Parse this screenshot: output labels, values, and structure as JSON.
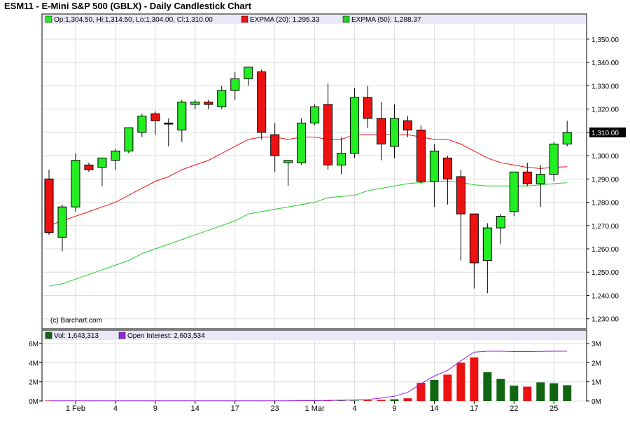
{
  "title": "ESM11 - E-Mini S&P 500 (GBLX) - Daily Candlestick Chart",
  "watermark": "(c) Barchart.com",
  "colors": {
    "up": "#22ee22",
    "down": "#ee1111",
    "ema20": "#ee1111",
    "ema50": "#22cc22",
    "oi": "#9922dd",
    "vol_up": "#116611",
    "vol_down": "#ee1111",
    "legend_bg": "#e8e8f8",
    "grid": "#dddddd"
  },
  "price_legend": {
    "ohlc": "Op:1,304.50, Hi:1,314.50, Lo:1,304.00, Cl:1,310.00",
    "ema20": "EXPMA (20): 1,295.33",
    "ema50": "EXPMA (50): 1,288.37"
  },
  "volume_legend": {
    "vol": "Vol: 1,643,313",
    "oi": "Open Interest: 2,603,534"
  },
  "last_price_label": "1,310.00",
  "chart_data": {
    "type": "candlestick",
    "x_tick_labels": [
      "1 Feb",
      "4",
      "9",
      "14",
      "17",
      "23",
      "1 Mar",
      "4",
      "9",
      "14",
      "17",
      "22",
      "25"
    ],
    "x_tick_bar_index": [
      2,
      5,
      8,
      11,
      14,
      17,
      20,
      23,
      26,
      29,
      32,
      35,
      38
    ],
    "price_axis": {
      "ylim": [
        1226,
        1356
      ],
      "ticks": [
        "1,230.00",
        "1,240.00",
        "1,250.00",
        "1,260.00",
        "1,270.00",
        "1,280.00",
        "1,290.00",
        "1,300.00",
        "1,310.00",
        "1,320.00",
        "1,330.00",
        "1,340.00",
        "1,350.00"
      ],
      "tick_values": [
        1230,
        1240,
        1250,
        1260,
        1270,
        1280,
        1290,
        1300,
        1310,
        1320,
        1330,
        1340,
        1350
      ]
    },
    "volume_left_axis": {
      "ticks": [
        "0M",
        "2M",
        "4M",
        "6M"
      ],
      "tick_values": [
        0,
        2,
        4,
        6
      ],
      "ylim": [
        0,
        6.3
      ]
    },
    "volume_right_axis": {
      "ticks": [
        "0M",
        "1M",
        "2M",
        "3M"
      ],
      "tick_values": [
        0,
        1,
        2,
        3
      ],
      "ylim": [
        0,
        3.15
      ]
    },
    "ohlc": [
      [
        1290,
        1294,
        1266,
        1267
      ],
      [
        1265,
        1279,
        1259,
        1278
      ],
      [
        1278,
        1301,
        1276,
        1298
      ],
      [
        1296,
        1297,
        1293,
        1294
      ],
      [
        1295,
        1299,
        1287,
        1299
      ],
      [
        1298,
        1303,
        1294,
        1302
      ],
      [
        1302,
        1312,
        1301,
        1312
      ],
      [
        1310,
        1318,
        1308,
        1317
      ],
      [
        1318,
        1319,
        1309,
        1315
      ],
      [
        1314,
        1316,
        1304,
        1314
      ],
      [
        1311,
        1324,
        1306,
        1323
      ],
      [
        1322,
        1324,
        1320,
        1323
      ],
      [
        1323,
        1324,
        1320,
        1322
      ],
      [
        1321,
        1330,
        1320,
        1328
      ],
      [
        1328,
        1336,
        1324,
        1333
      ],
      [
        1333,
        1338,
        1330,
        1338
      ],
      [
        1336,
        1337,
        1307,
        1310
      ],
      [
        1309,
        1314,
        1293,
        1300
      ],
      [
        1297,
        1298,
        1287,
        1298
      ],
      [
        1297,
        1316,
        1296,
        1314
      ],
      [
        1314,
        1322,
        1313,
        1321
      ],
      [
        1322,
        1331,
        1294,
        1296
      ],
      [
        1296,
        1308,
        1292,
        1301
      ],
      [
        1301,
        1329,
        1299,
        1325
      ],
      [
        1325,
        1330,
        1312,
        1316
      ],
      [
        1316,
        1323,
        1298,
        1305
      ],
      [
        1304,
        1322,
        1299,
        1316
      ],
      [
        1315,
        1317,
        1308,
        1311
      ],
      [
        1311,
        1313,
        1288,
        1289
      ],
      [
        1289,
        1305,
        1278,
        1302
      ],
      [
        1299,
        1300,
        1279,
        1290
      ],
      [
        1291,
        1294,
        1255,
        1275
      ],
      [
        1275,
        1275,
        1243,
        1254
      ],
      [
        1255,
        1271,
        1241,
        1269
      ],
      [
        1269,
        1275,
        1262,
        1274
      ],
      [
        1276,
        1288,
        1274,
        1293
      ],
      [
        1293,
        1297,
        1287,
        1288
      ],
      [
        1288,
        1296,
        1278,
        1292
      ],
      [
        1292,
        1306,
        1289,
        1305
      ],
      [
        1305,
        1315,
        1304,
        1310
      ]
    ],
    "ema20": [
      1270,
      1272,
      1274,
      1276,
      1278,
      1280,
      1283,
      1286,
      1289,
      1291,
      1294,
      1296,
      1298,
      1301,
      1304,
      1307,
      1308,
      1308,
      1307,
      1308,
      1308,
      1307,
      1307,
      1309,
      1309,
      1309,
      1309,
      1309,
      1308,
      1307,
      1307,
      1305,
      1302,
      1299,
      1297,
      1296,
      1295,
      1294.5,
      1295,
      1295.3
    ],
    "ema50": [
      1244,
      1245,
      1247,
      1249,
      1251,
      1253,
      1255,
      1258,
      1260,
      1262,
      1264,
      1266,
      1268,
      1270,
      1272,
      1275,
      1276,
      1277,
      1278,
      1279,
      1280,
      1282,
      1282.5,
      1283,
      1285,
      1286,
      1287,
      1288,
      1288.5,
      1289,
      1289,
      1288.5,
      1287.5,
      1287,
      1287,
      1287,
      1287,
      1287.5,
      1288,
      1288.4
    ],
    "volume_m": [
      0.04,
      0.04,
      0.04,
      0.04,
      0.04,
      0.04,
      0.04,
      0.04,
      0.04,
      0.04,
      0.04,
      0.04,
      0.04,
      0.04,
      0.04,
      0.04,
      0.04,
      0.04,
      0.04,
      0.04,
      0.04,
      0.04,
      0.04,
      0.04,
      0.08,
      0.12,
      0.18,
      0.28,
      1.9,
      2.2,
      2.75,
      4.0,
      4.55,
      3.0,
      2.3,
      1.6,
      1.5,
      1.95,
      1.85,
      1.65
    ],
    "open_interest_m": [
      0.01,
      0.01,
      0.01,
      0.01,
      0.01,
      0.01,
      0.01,
      0.01,
      0.01,
      0.01,
      0.01,
      0.01,
      0.01,
      0.01,
      0.01,
      0.01,
      0.01,
      0.01,
      0.01,
      0.02,
      0.02,
      0.03,
      0.04,
      0.05,
      0.08,
      0.15,
      0.25,
      0.45,
      0.9,
      1.3,
      1.6,
      2.1,
      2.55,
      2.6,
      2.6,
      2.58,
      2.58,
      2.59,
      2.6,
      2.6
    ]
  }
}
